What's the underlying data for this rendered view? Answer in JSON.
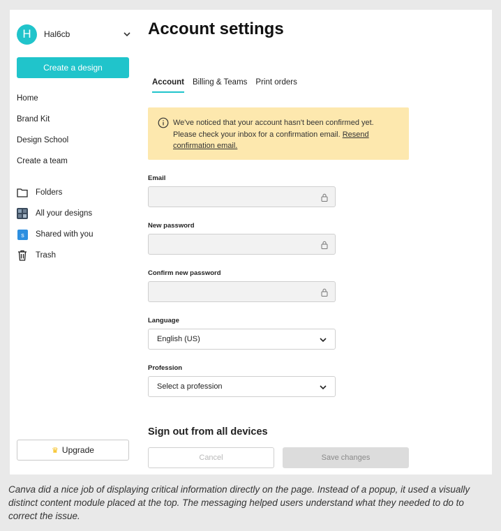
{
  "user": {
    "initial": "H",
    "name": "Hal6cb"
  },
  "sidebar": {
    "create_button": "Create a design",
    "nav": [
      {
        "label": "Home"
      },
      {
        "label": "Brand Kit"
      },
      {
        "label": "Design School"
      },
      {
        "label": "Create a team"
      }
    ],
    "library": [
      {
        "label": "Folders",
        "icon": "folder-icon"
      },
      {
        "label": "All your designs",
        "icon": "designs-thumbnail-icon"
      },
      {
        "label": "Shared with you",
        "icon": "shared-icon"
      },
      {
        "label": "Trash",
        "icon": "trash-icon"
      }
    ],
    "upgrade_button": "Upgrade"
  },
  "main": {
    "title": "Account settings",
    "tabs": [
      {
        "label": "Account",
        "active": true
      },
      {
        "label": "Billing & Teams",
        "active": false
      },
      {
        "label": "Print orders",
        "active": false
      }
    ],
    "notice": {
      "line1": "We've noticed that your account hasn't been confirmed yet.",
      "line2": "Please check your inbox for a confirmation email.",
      "link_part1": "Resend",
      "link_part2": "confirmation email."
    },
    "fields": {
      "email_label": "Email",
      "email_value": "",
      "new_password_label": "New password",
      "new_password_value": "",
      "confirm_password_label": "Confirm new password",
      "confirm_password_value": "",
      "language_label": "Language",
      "language_value": "English (US)",
      "profession_label": "Profession",
      "profession_value": "Select a profession"
    },
    "signout_heading": "Sign out from all devices",
    "cancel_button": "Cancel",
    "save_button": "Save changes"
  },
  "colors": {
    "accent": "#20c4cb",
    "notice_bg": "#fde8ae",
    "upgrade_crown": "#f5b800"
  },
  "caption": "Canva did a nice job of displaying critical information directly on the page. Instead of a popup, it used a visually distinct content module placed at the top. The messaging helped users understand what they needed to do to correct the issue."
}
